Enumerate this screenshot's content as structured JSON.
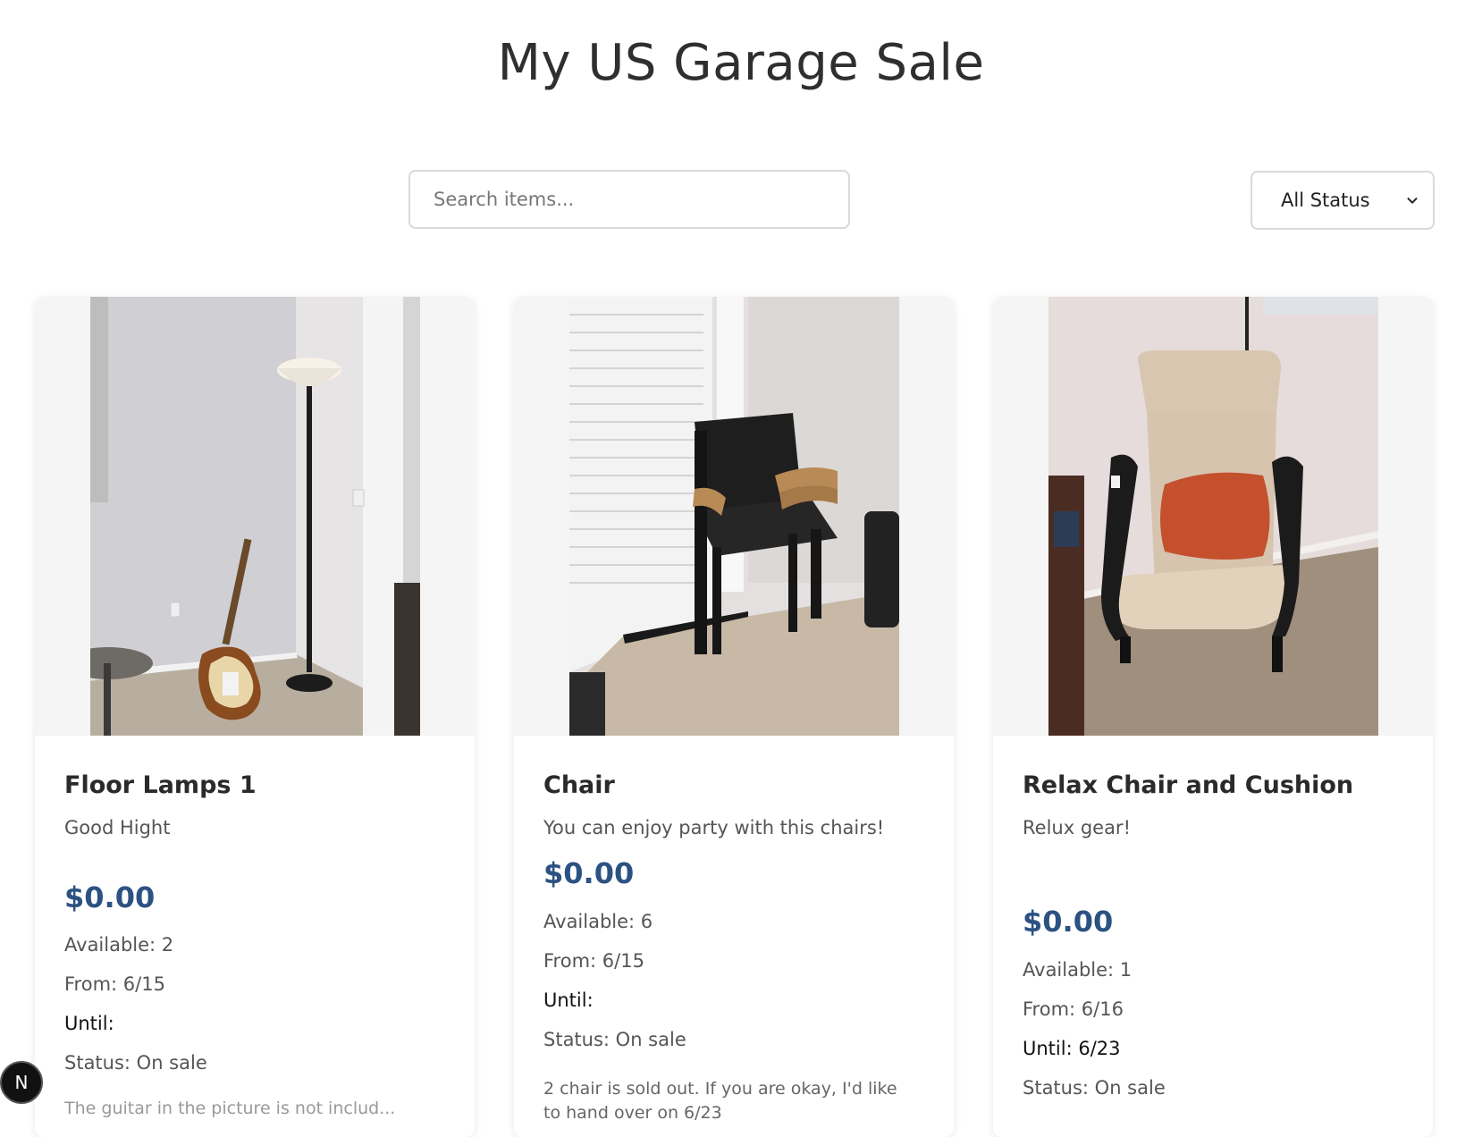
{
  "header": {
    "title": "My US Garage Sale"
  },
  "filters": {
    "search_placeholder": "Search items...",
    "status_selected": "All Status"
  },
  "items": [
    {
      "name": "Floor Lamps 1",
      "description": "Good Hight",
      "price": "$0.00",
      "available": "Available: 2",
      "from": "From: 6/15",
      "until": "Until:",
      "status": "Status: On sale",
      "note": "The guitar in the picture is not includ..."
    },
    {
      "name": "Chair",
      "description": "You can enjoy party with this chairs!",
      "price": "$0.00",
      "available": "Available: 6",
      "from": "From: 6/15",
      "until": "Until:",
      "status": "Status: On sale",
      "note": "2 chair is sold out. If you are okay, I'd like to hand over on 6/23"
    },
    {
      "name": "Relax Chair and Cushion",
      "description": "Relux gear!",
      "price": "$0.00",
      "available": "Available: 1",
      "from": "From: 6/16",
      "until": "Until: 6/23",
      "status": "Status: On sale"
    }
  ],
  "badge": {
    "letter": "N"
  },
  "colors": {
    "price": "#2c5282",
    "card_image_bg": "#f5f5f5"
  }
}
